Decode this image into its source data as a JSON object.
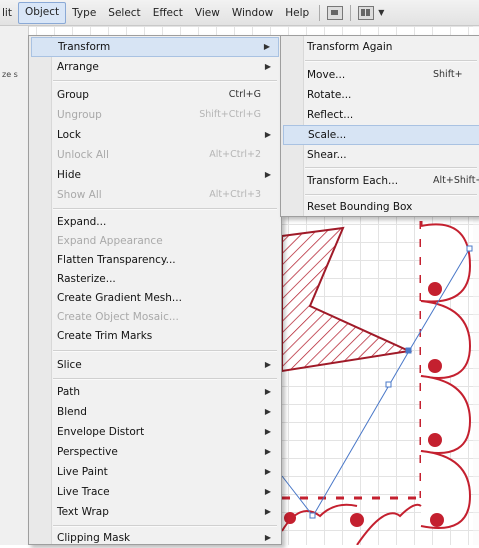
{
  "menubar": {
    "items": [
      "lit",
      "Object",
      "Type",
      "Select",
      "Effect",
      "View",
      "Window",
      "Help"
    ]
  },
  "side_panel": {
    "tab_text": "ze s"
  },
  "object_menu": {
    "items": [
      {
        "label": "Transform",
        "shortcut": "",
        "submenu": true,
        "disabled": false
      },
      {
        "label": "Arrange",
        "shortcut": "",
        "submenu": true,
        "disabled": false
      },
      {
        "label": "Group",
        "shortcut": "Ctrl+G",
        "submenu": false,
        "disabled": false
      },
      {
        "label": "Ungroup",
        "shortcut": "Shift+Ctrl+G",
        "submenu": false,
        "disabled": true
      },
      {
        "label": "Lock",
        "shortcut": "",
        "submenu": true,
        "disabled": false
      },
      {
        "label": "Unlock All",
        "shortcut": "Alt+Ctrl+2",
        "submenu": false,
        "disabled": true
      },
      {
        "label": "Hide",
        "shortcut": "",
        "submenu": true,
        "disabled": false
      },
      {
        "label": "Show All",
        "shortcut": "Alt+Ctrl+3",
        "submenu": false,
        "disabled": true
      },
      {
        "label": "Expand...",
        "shortcut": "",
        "submenu": false,
        "disabled": false
      },
      {
        "label": "Expand Appearance",
        "shortcut": "",
        "submenu": false,
        "disabled": true
      },
      {
        "label": "Flatten Transparency...",
        "shortcut": "",
        "submenu": false,
        "disabled": false
      },
      {
        "label": "Rasterize...",
        "shortcut": "",
        "submenu": false,
        "disabled": false
      },
      {
        "label": "Create Gradient Mesh...",
        "shortcut": "",
        "submenu": false,
        "disabled": false
      },
      {
        "label": "Create Object Mosaic...",
        "shortcut": "",
        "submenu": false,
        "disabled": true
      },
      {
        "label": "Create Trim Marks",
        "shortcut": "",
        "submenu": false,
        "disabled": false
      },
      {
        "label": "Slice",
        "shortcut": "",
        "submenu": true,
        "disabled": false
      },
      {
        "label": "Path",
        "shortcut": "",
        "submenu": true,
        "disabled": false
      },
      {
        "label": "Blend",
        "shortcut": "",
        "submenu": true,
        "disabled": false
      },
      {
        "label": "Envelope Distort",
        "shortcut": "",
        "submenu": true,
        "disabled": false
      },
      {
        "label": "Perspective",
        "shortcut": "",
        "submenu": true,
        "disabled": false
      },
      {
        "label": "Live Paint",
        "shortcut": "",
        "submenu": true,
        "disabled": false
      },
      {
        "label": "Live Trace",
        "shortcut": "",
        "submenu": true,
        "disabled": false
      },
      {
        "label": "Text Wrap",
        "shortcut": "",
        "submenu": true,
        "disabled": false
      },
      {
        "label": "Clipping Mask",
        "shortcut": "",
        "submenu": true,
        "disabled": false
      }
    ]
  },
  "transform_submenu": {
    "items": [
      {
        "label": "Transform Again",
        "shortcut": ""
      },
      {
        "label": "Move...",
        "shortcut": "Shift+"
      },
      {
        "label": "Rotate...",
        "shortcut": ""
      },
      {
        "label": "Reflect...",
        "shortcut": ""
      },
      {
        "label": "Scale...",
        "shortcut": ""
      },
      {
        "label": "Shear...",
        "shortcut": ""
      },
      {
        "label": "Transform Each...",
        "shortcut": "Alt+Shift+"
      },
      {
        "label": "Reset Bounding Box",
        "shortcut": ""
      }
    ]
  },
  "colors": {
    "artwork_red": "#c4202f",
    "selection_blue": "#4a78c8",
    "menu_highlight": "#d7e4f4"
  }
}
